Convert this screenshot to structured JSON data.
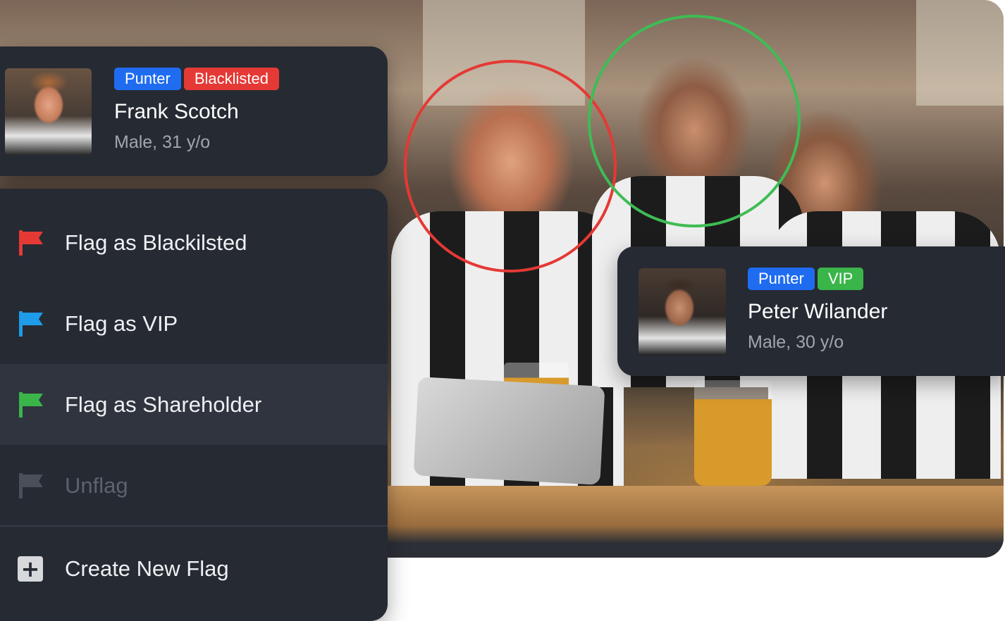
{
  "profiles": [
    {
      "badges": [
        "Punter",
        "Blacklisted"
      ],
      "name": "Frank Scotch",
      "meta": "Male, 31 y/o"
    },
    {
      "badges": [
        "Punter",
        "VIP"
      ],
      "name": "Peter Wilander",
      "meta": "Male, 30 y/o"
    }
  ],
  "menu": {
    "items": [
      {
        "label": "Flag as Blackilsted",
        "icon": "red-flag-icon",
        "color": "#e53935"
      },
      {
        "label": "Flag as VIP",
        "icon": "blue-flag-icon",
        "color": "#1e9be9"
      },
      {
        "label": "Flag as Shareholder",
        "icon": "green-flag-icon",
        "color": "#3ab54a"
      },
      {
        "label": "Unflag",
        "icon": "gray-flag-icon",
        "color": "#4a4f59"
      },
      {
        "label": "Create New Flag",
        "icon": "plus-icon"
      }
    ]
  },
  "colors": {
    "punter": "#1f6cf0",
    "blacklisted": "#e53935",
    "vip": "#3ab54a",
    "ring_blacklisted": "#e53935",
    "ring_vip": "#3ebc55",
    "panel": "#262a33"
  }
}
